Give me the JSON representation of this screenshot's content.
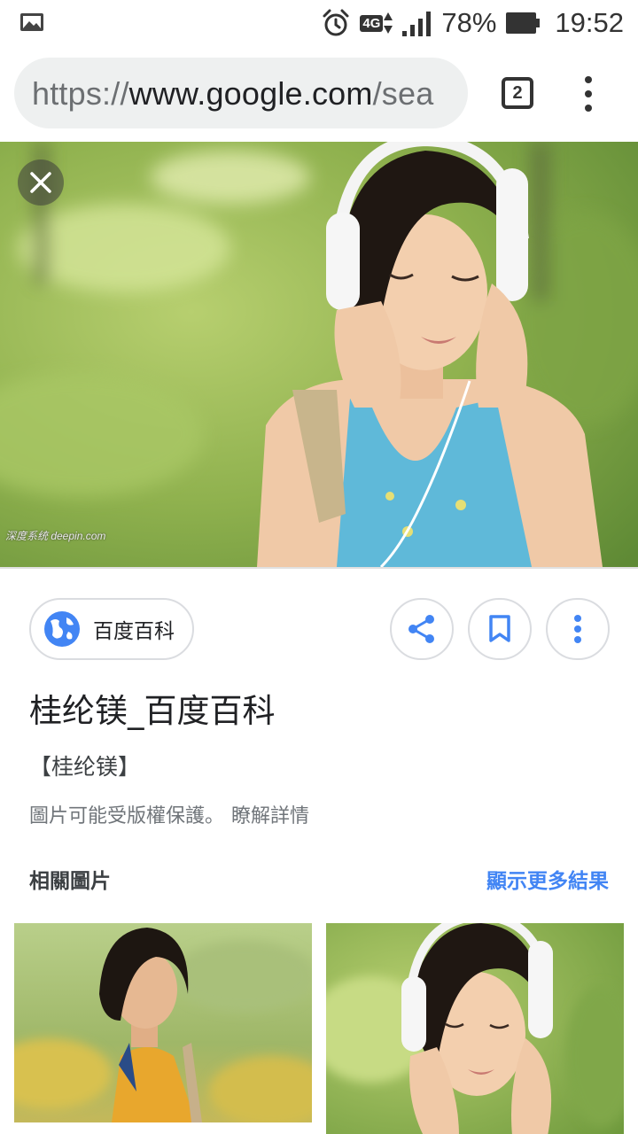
{
  "status_bar": {
    "network_label": "4G",
    "battery_percent": "78%",
    "time": "19:52",
    "icons": [
      "gallery-icon",
      "alarm-icon",
      "data-arrows-icon",
      "signal-icon",
      "battery-icon"
    ]
  },
  "browser": {
    "url_scheme": "https://",
    "url_host": "www.google.com",
    "url_path": "/sea",
    "tab_count": "2"
  },
  "viewer": {
    "watermark": "深度系统 deepin.com",
    "source": {
      "name": "百度百科"
    },
    "title": "桂纶镁_百度百科",
    "snippet": "【桂纶镁】",
    "copyright_notice": "圖片可能受版權保護。",
    "learn_more": "瞭解詳情",
    "related_heading": "相關圖片",
    "show_more": "顯示更多結果"
  },
  "colors": {
    "accent": "#4285f4",
    "url_pill": "#eef0f0",
    "border": "#dadce0"
  }
}
